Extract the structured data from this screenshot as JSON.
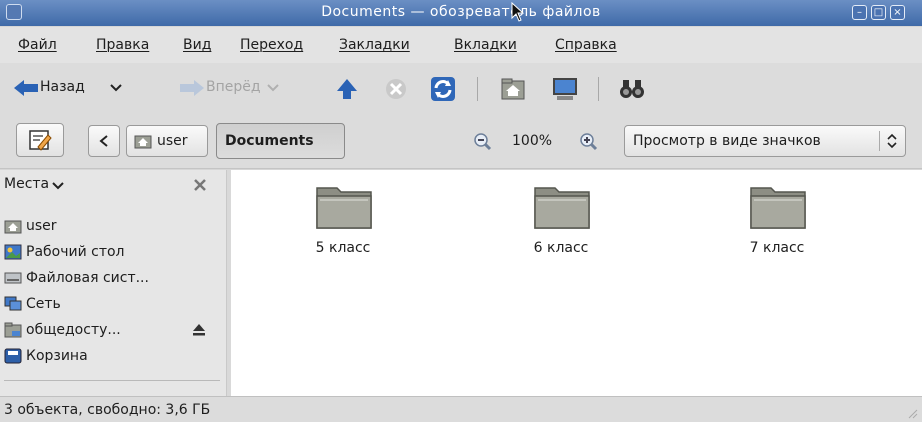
{
  "window": {
    "title": "Documents — обозреватель файлов"
  },
  "menu": [
    "Файл",
    "Правка",
    "Вид",
    "Переход",
    "Закладки",
    "Вкладки",
    "Справка"
  ],
  "toolbar": {
    "back_label": "Назад",
    "forward_label": "Вперёд"
  },
  "location": {
    "parent": "user",
    "current": "Documents"
  },
  "zoom": {
    "level": "100%"
  },
  "view_select": {
    "value": "Просмотр в виде значков"
  },
  "sidebar": {
    "header": "Места",
    "items": [
      {
        "label": "user",
        "icon": "home-folder-icon"
      },
      {
        "label": "Рабочий стол",
        "icon": "desktop-icon"
      },
      {
        "label": "Файловая сист...",
        "icon": "filesystem-icon"
      },
      {
        "label": "Сеть",
        "icon": "network-icon"
      },
      {
        "label": "общедосту...",
        "icon": "shared-folder-icon"
      },
      {
        "label": "Корзина",
        "icon": "trash-icon"
      }
    ]
  },
  "files": [
    {
      "name": "5 класс",
      "icon": "folder-icon"
    },
    {
      "name": "6 класс",
      "icon": "folder-icon"
    },
    {
      "name": "7 класс",
      "icon": "folder-icon"
    }
  ],
  "status": {
    "text": "3 объекта, свободно: 3,6 ГБ"
  },
  "colors": {
    "titlebar": "#4a74b1",
    "folder": "#8d8e84",
    "main_bg": "#ffffff"
  }
}
